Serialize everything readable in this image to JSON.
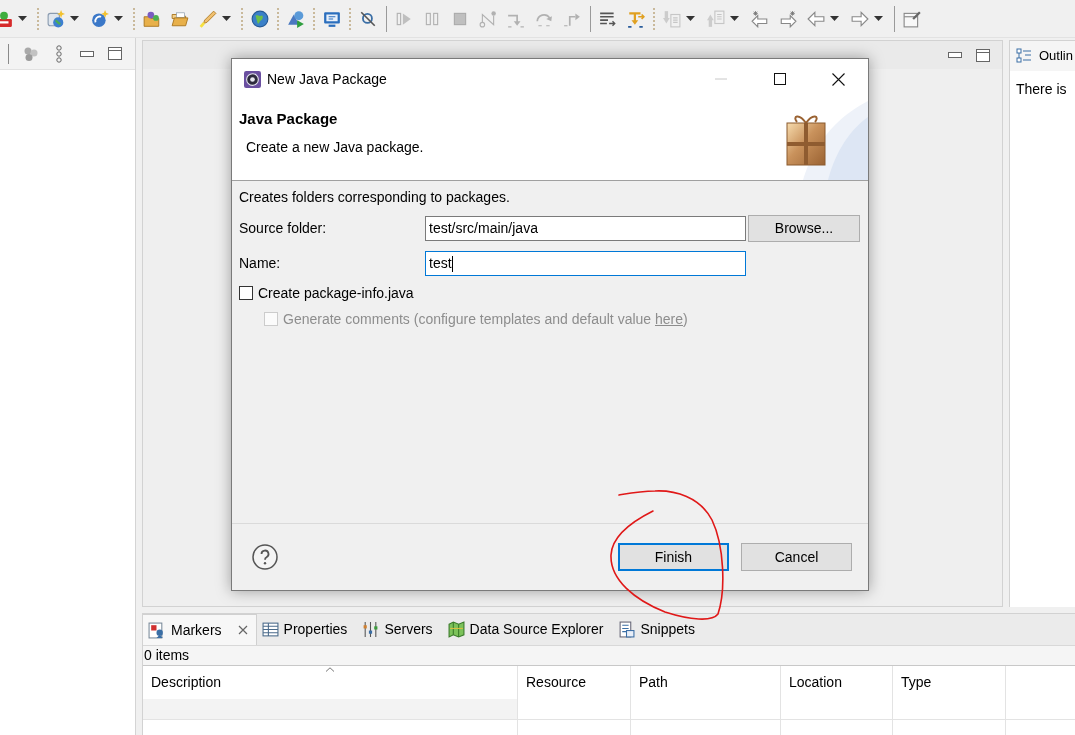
{
  "toolbar": [
    {
      "kind": "button",
      "dropdown": true,
      "disabled": false
    },
    {
      "kind": "separator"
    },
    {
      "kind": "button",
      "dropdown": true,
      "disabled": false
    },
    {
      "kind": "button",
      "dropdown": true,
      "disabled": false
    },
    {
      "kind": "separator"
    },
    {
      "kind": "button",
      "disabled": false
    },
    {
      "kind": "button",
      "disabled": false
    },
    {
      "kind": "button",
      "dropdown": true,
      "disabled": false
    },
    {
      "kind": "separator"
    },
    {
      "kind": "button",
      "disabled": false
    },
    {
      "kind": "separator"
    },
    {
      "kind": "button",
      "disabled": false
    },
    {
      "kind": "separator"
    },
    {
      "kind": "button",
      "disabled": false
    },
    {
      "kind": "separator"
    },
    {
      "kind": "button",
      "disabled": false
    },
    {
      "kind": "divider"
    },
    {
      "kind": "button",
      "disabled": true
    },
    {
      "kind": "button",
      "disabled": true
    },
    {
      "kind": "button",
      "disabled": true
    },
    {
      "kind": "button",
      "disabled": true
    },
    {
      "kind": "button",
      "disabled": true
    },
    {
      "kind": "button",
      "disabled": true
    },
    {
      "kind": "button",
      "disabled": true
    },
    {
      "kind": "divider"
    },
    {
      "kind": "button",
      "disabled": false
    },
    {
      "kind": "button",
      "disabled": false
    },
    {
      "kind": "separator"
    },
    {
      "kind": "button",
      "dropdown": true,
      "disabled": true
    },
    {
      "kind": "button",
      "dropdown": true,
      "disabled": true
    },
    {
      "kind": "button",
      "disabled": false
    },
    {
      "kind": "button",
      "disabled": false
    },
    {
      "kind": "button",
      "dropdown": true,
      "disabled": false
    },
    {
      "kind": "button",
      "dropdown": true,
      "disabled": false
    },
    {
      "kind": "divider"
    },
    {
      "kind": "button",
      "disabled": false
    }
  ],
  "outline_panel": {
    "tab": "Outlin",
    "message": "There is"
  },
  "bottom_panel": {
    "tabs": [
      {
        "label": "Markers",
        "selected": true
      },
      {
        "label": "Properties",
        "selected": false
      },
      {
        "label": "Servers",
        "selected": false
      },
      {
        "label": "Data Source Explorer",
        "selected": false
      },
      {
        "label": "Snippets",
        "selected": false
      }
    ],
    "status": "0 items",
    "table": {
      "columns": [
        {
          "label": "Description",
          "sorted": true
        },
        {
          "label": "Resource",
          "sorted": false
        },
        {
          "label": "Path",
          "sorted": false
        },
        {
          "label": "Location",
          "sorted": false
        },
        {
          "label": "Type",
          "sorted": false
        }
      ]
    }
  },
  "dialog": {
    "title": "New Java Package",
    "minimize_disabled": true,
    "header": {
      "title": "Java Package",
      "description": "Create a new Java package."
    },
    "message": "Creates folders corresponding to packages.",
    "fields": [
      {
        "label": "Source folder:",
        "value": "test/src/main/java",
        "focused": false,
        "button": "Browse..."
      },
      {
        "label": "Name:",
        "value": "test",
        "focused": true
      }
    ],
    "options": [
      {
        "label": "Create package-info.java",
        "checked": false,
        "disabled": false,
        "children": [
          {
            "label": "Generate comments (configure templates and default value ",
            "link": "here",
            "label_end": ")",
            "checked": false,
            "disabled": true
          }
        ]
      }
    ],
    "buttons": [
      {
        "label": "Finish",
        "default": true
      },
      {
        "label": "Cancel",
        "default": false
      }
    ]
  }
}
